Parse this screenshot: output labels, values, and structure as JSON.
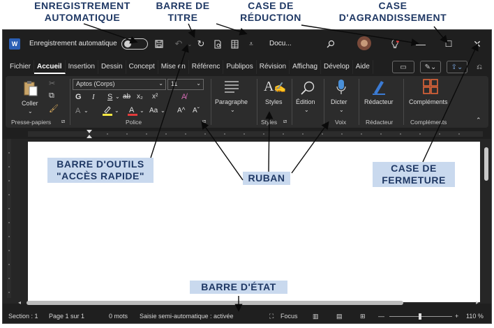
{
  "callouts": {
    "autosave": "ENREGISTREMENT\nAUTOMATIQUE",
    "titlebar": "BARRE DE\nTITRE",
    "minimize": "CASE DE\nRÉDUCTION",
    "maximize": "CASE\nD'AGRANDISSEMENT",
    "qat": "BARRE D'OUTILS\n\"ACCÈS RAPIDE\"",
    "ribbon": "RUBAN",
    "close": "CASE DE\nFERMETURE",
    "statusbar": "BARRE D'ÉTAT"
  },
  "titlebar": {
    "app_icon_letter": "W",
    "autosave_label": "Enregistrement automatique",
    "doc_title": "Docu...",
    "minimize_glyph": "—",
    "maximize_glyph": "☐",
    "close_glyph": "✕"
  },
  "tabs": [
    "Fichier",
    "Accueil",
    "Insertion",
    "Dessin",
    "Concept",
    "Mise en",
    "Référenc",
    "Publipos",
    "Révision",
    "Affichag",
    "Dévelop",
    "Aide"
  ],
  "ribbon": {
    "paste_label": "Coller",
    "font_name": "Aptos (Corps)",
    "font_size": "11",
    "bold": "G",
    "italic": "I",
    "underline": "S",
    "strike": "ab",
    "subscript": "x₂",
    "superscript": "x²",
    "change_case": "Aa",
    "grow_font": "A^",
    "shrink_font": "Aˇ",
    "paragraph_label": "Paragraphe",
    "styles_label": "Styles",
    "editing_label": "Édition",
    "dictate_label": "Dicter",
    "editor_label": "Rédacteur",
    "addins_label": "Compléments",
    "groups": {
      "clipboard": "Presse-papiers",
      "font": "Police",
      "styles": "Styles",
      "voice": "Voix",
      "editor": "Rédacteur",
      "addins": "Compléments"
    }
  },
  "statusbar": {
    "section": "Section : 1",
    "page": "Page 1 sur 1",
    "words": "0 mots",
    "autocomplete": "Saisie semi-automatique : activée",
    "focus": "Focus",
    "zoom": "110 %"
  },
  "colors": {
    "callout_text": "#1f3864",
    "callout_box": "#c9d9ee",
    "window_bg": "#1f1f1f",
    "ribbon_bg": "#2c2c2c",
    "word_blue": "#2b5fb5",
    "highlight_yellow": "#f5e642",
    "font_red": "#e23b3b",
    "addins_orange": "#e0653a"
  }
}
